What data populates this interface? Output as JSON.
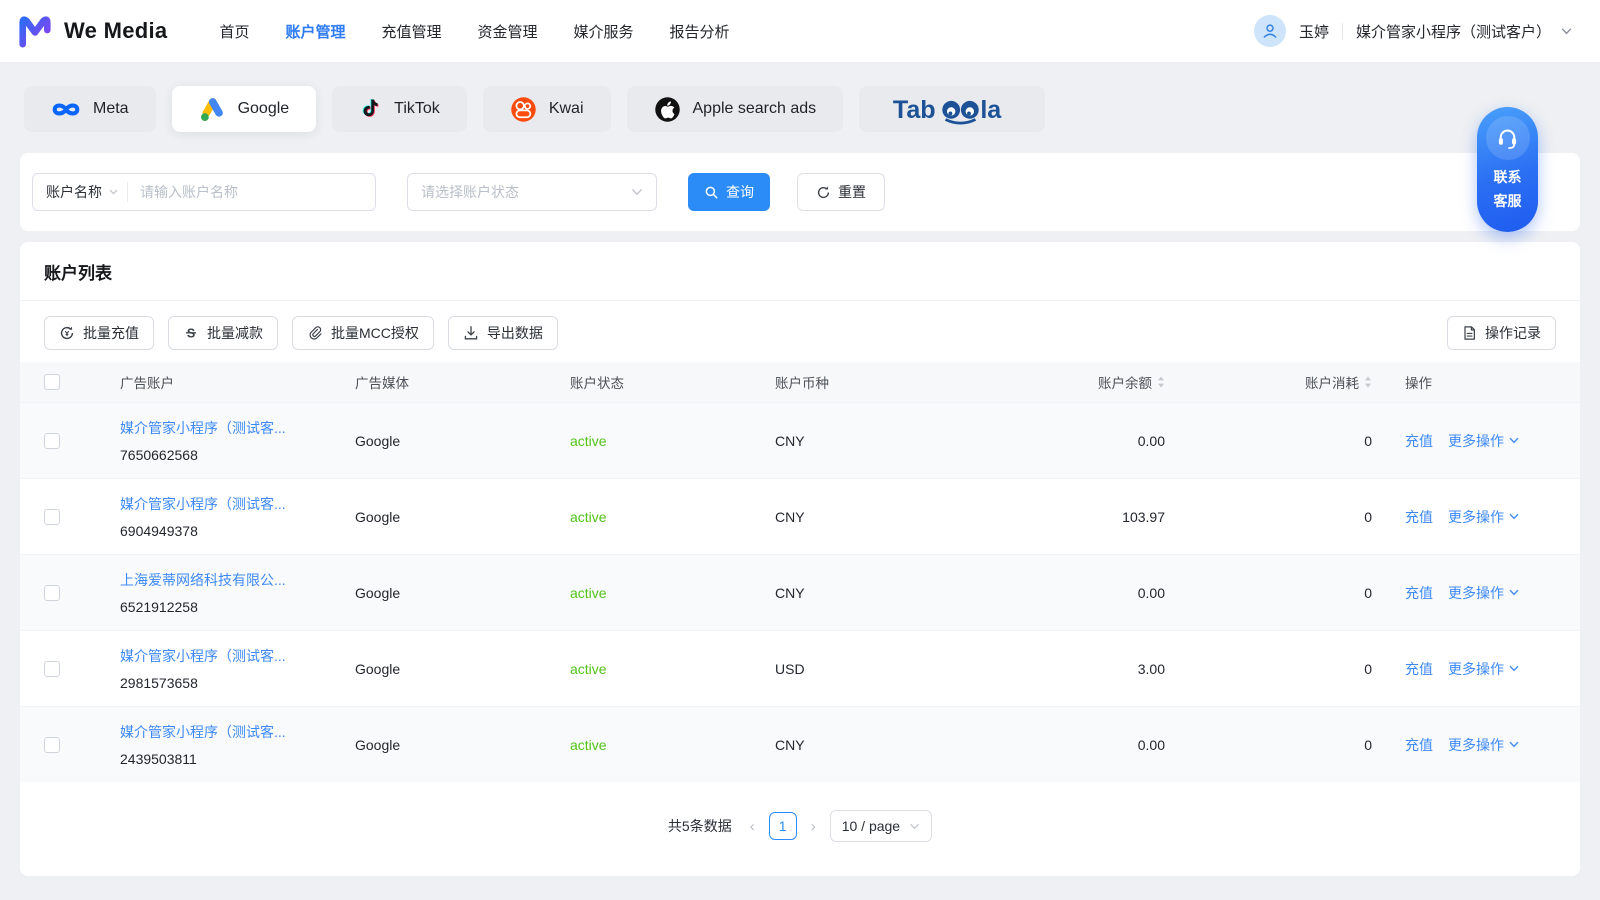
{
  "brand": {
    "name": "We Media"
  },
  "nav": {
    "items": [
      {
        "label": "首页",
        "active": false
      },
      {
        "label": "账户管理",
        "active": true
      },
      {
        "label": "充值管理",
        "active": false
      },
      {
        "label": "资金管理",
        "active": false
      },
      {
        "label": "媒介服务",
        "active": false
      },
      {
        "label": "报告分析",
        "active": false
      }
    ]
  },
  "user": {
    "name": "玉婷",
    "org": "媒介管家小程序（测试客户）"
  },
  "platform_tabs": [
    {
      "label": "Meta",
      "icon": "meta-icon",
      "active": false
    },
    {
      "label": "Google",
      "icon": "google-ads-icon",
      "active": true
    },
    {
      "label": "TikTok",
      "icon": "tiktok-icon",
      "active": false
    },
    {
      "label": "Kwai",
      "icon": "kwai-icon",
      "active": false
    },
    {
      "label": "Apple search ads",
      "icon": "apple-icon",
      "active": false
    },
    {
      "label": "Taboola",
      "logo_parts": {
        "left": "Tab",
        "right": "la"
      },
      "active": false
    }
  ],
  "contact": {
    "line1": "联系",
    "line2": "客服"
  },
  "filters": {
    "field_select": "账户名称",
    "name_placeholder": "请输入账户名称",
    "status_placeholder": "请选择账户状态",
    "search_label": "查询",
    "reset_label": "重置"
  },
  "list": {
    "title": "账户列表",
    "toolbar": {
      "recharge": "批量充值",
      "deduct": "批量减款",
      "mcc": "批量MCC授权",
      "export": "导出数据",
      "records": "操作记录"
    },
    "columns": {
      "account": "广告账户",
      "media": "广告媒体",
      "status": "账户状态",
      "currency": "账户币种",
      "balance": "账户余额",
      "spend": "账户消耗",
      "actions": "操作"
    },
    "row_actions": {
      "recharge": "充值",
      "more": "更多操作"
    },
    "rows": [
      {
        "name": "媒介管家小程序（测试客...",
        "id": "7650662568",
        "media": "Google",
        "status": "active",
        "currency": "CNY",
        "balance": "0.00",
        "spend": "0"
      },
      {
        "name": "媒介管家小程序（测试客...",
        "id": "6904949378",
        "media": "Google",
        "status": "active",
        "currency": "CNY",
        "balance": "103.97",
        "spend": "0"
      },
      {
        "name": "上海爱蒂网络科技有限公...",
        "id": "6521912258",
        "media": "Google",
        "status": "active",
        "currency": "CNY",
        "balance": "0.00",
        "spend": "0"
      },
      {
        "name": "媒介管家小程序（测试客...",
        "id": "2981573658",
        "media": "Google",
        "status": "active",
        "currency": "USD",
        "balance": "3.00",
        "spend": "0"
      },
      {
        "name": "媒介管家小程序（测试客...",
        "id": "2439503811",
        "media": "Google",
        "status": "active",
        "currency": "CNY",
        "balance": "0.00",
        "spend": "0"
      }
    ]
  },
  "pagination": {
    "total": "共5条数据",
    "page": "1",
    "page_size": "10 / page"
  },
  "colors": {
    "accent_blue": "#2b8cf7",
    "link_blue": "#3d8af7",
    "nav_active_blue": "#2e7cf6",
    "status_active_green": "#52c41a",
    "page_bg": "#eef0f3",
    "meta_blue": "#0866ff",
    "kwai_orange": "#fb4b0f",
    "taboola_navy": "#1d5296",
    "contact_gradient_start": "#49a0fb",
    "contact_gradient_end": "#1e5cf0"
  }
}
